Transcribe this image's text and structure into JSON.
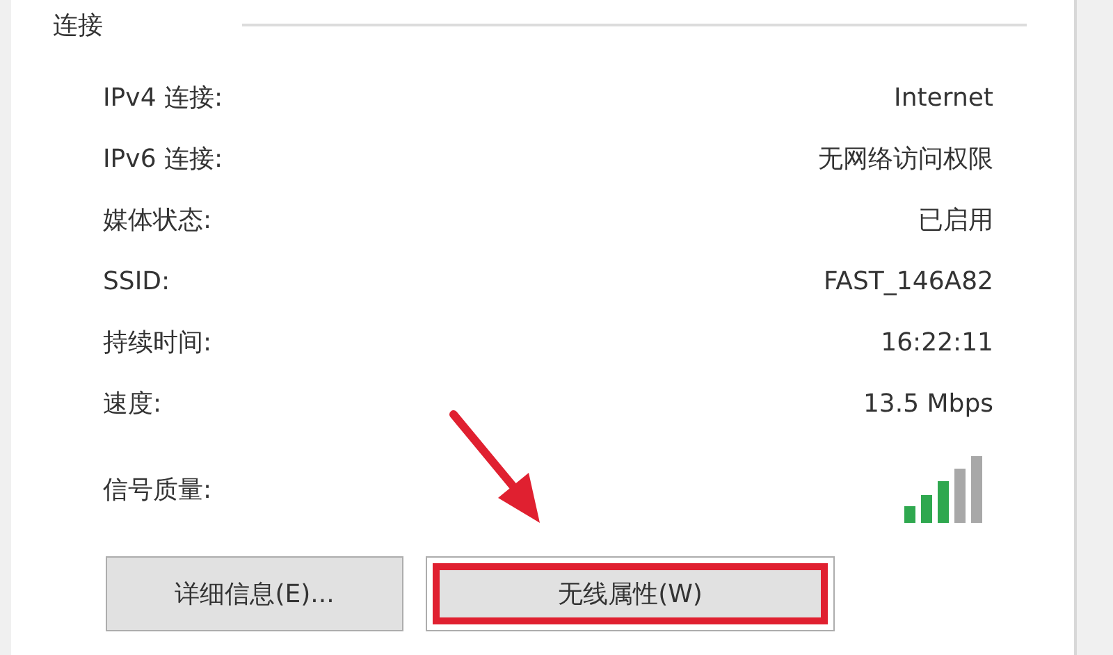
{
  "group": {
    "title": "连接"
  },
  "rows": [
    {
      "label": "IPv4 连接:",
      "value": "Internet",
      "kind": "text"
    },
    {
      "label": "IPv6 连接:",
      "value": "无网络访问权限",
      "kind": "text"
    },
    {
      "label": "媒体状态:",
      "value": "已启用",
      "kind": "text"
    },
    {
      "label": "SSID:",
      "value": "FAST_146A82",
      "kind": "text"
    },
    {
      "label": "持续时间:",
      "value": "16:22:11",
      "kind": "text"
    },
    {
      "label": "速度:",
      "value": "13.5 Mbps",
      "kind": "text"
    },
    {
      "label": "信号质量:",
      "kind": "signal"
    }
  ],
  "buttons": [
    {
      "label": "详细信息(E)...",
      "highlighted": false
    },
    {
      "label": "无线属性(W)",
      "highlighted": true
    }
  ]
}
